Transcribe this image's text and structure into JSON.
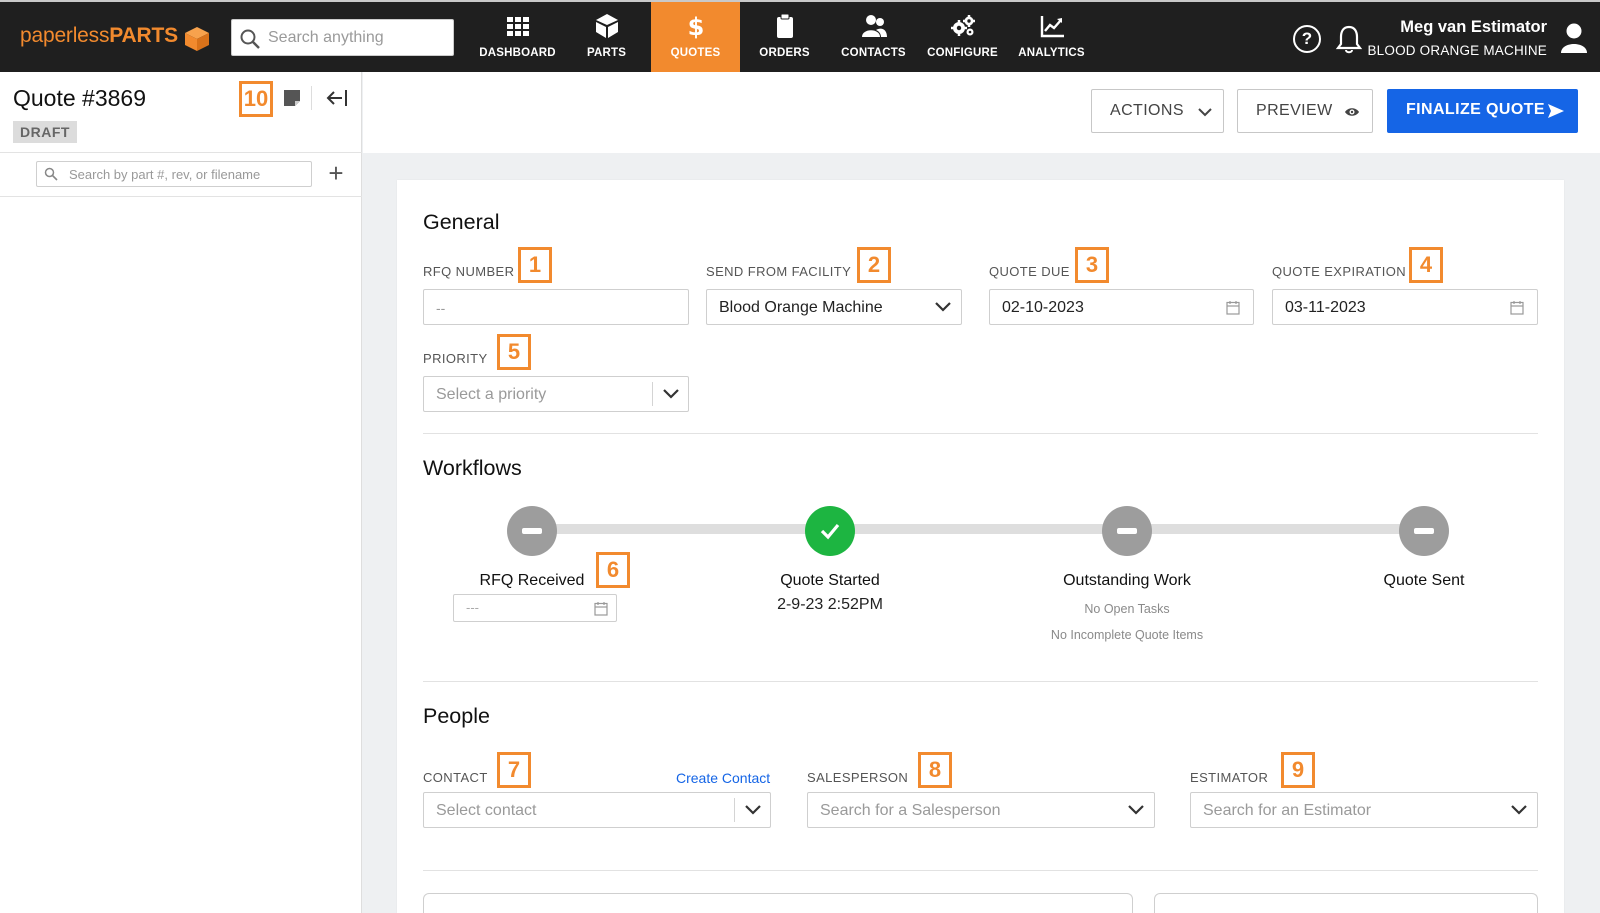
{
  "nav": {
    "logo_prefix": "paperless",
    "logo_suffix": "PARTS",
    "search_placeholder": "Search anything",
    "items": [
      {
        "label": "DASHBOARD",
        "icon": "grid-icon"
      },
      {
        "label": "PARTS",
        "icon": "cube-icon"
      },
      {
        "label": "QUOTES",
        "icon": "dollar-icon",
        "active": true
      },
      {
        "label": "ORDERS",
        "icon": "clipboard-icon"
      },
      {
        "label": "CONTACTS",
        "icon": "people-icon"
      },
      {
        "label": "CONFIGURE",
        "icon": "gears-icon"
      },
      {
        "label": "ANALYTICS",
        "icon": "chart-icon"
      }
    ],
    "help_glyph": "?",
    "user_name": "Meg van Estimator",
    "company": "BLOOD ORANGE MACHINE"
  },
  "left": {
    "quote_title": "Quote #3869",
    "status": "DRAFT",
    "part_search_placeholder": "Search by part #, rev, or filename",
    "add_glyph": "+",
    "badge": "10"
  },
  "actions": {
    "actions_label": "ACTIONS",
    "preview_label": "PREVIEW",
    "finalize_label": "FINALIZE QUOTE"
  },
  "general": {
    "heading": "General",
    "rfq_number": {
      "label": "RFQ NUMBER",
      "placeholder": "--",
      "badge": "1"
    },
    "facility": {
      "label": "SEND FROM FACILITY",
      "value": "Blood Orange Machine",
      "badge": "2"
    },
    "quote_due": {
      "label": "QUOTE DUE",
      "value": "02-10-2023",
      "badge": "3"
    },
    "quote_expiration": {
      "label": "QUOTE EXPIRATION",
      "value": "03-11-2023",
      "badge": "4"
    },
    "priority": {
      "label": "PRIORITY",
      "placeholder": "Select a priority",
      "badge": "5"
    }
  },
  "workflows": {
    "heading": "Workflows",
    "steps": [
      {
        "title": "RFQ Received",
        "date_placeholder": "---",
        "badge": "6",
        "state": "pending"
      },
      {
        "title": "Quote Started",
        "sub": "2-9-23 2:52PM",
        "state": "done"
      },
      {
        "title": "Outstanding Work",
        "note1": "No Open Tasks",
        "note2": "No Incomplete Quote Items",
        "state": "pending"
      },
      {
        "title": "Quote Sent",
        "state": "pending"
      }
    ]
  },
  "people": {
    "heading": "People",
    "contact": {
      "label": "CONTACT",
      "placeholder": "Select contact",
      "link": "Create Contact",
      "badge": "7"
    },
    "salesperson": {
      "label": "SALESPERSON",
      "placeholder": "Search for a Salesperson",
      "badge": "8"
    },
    "estimator": {
      "label": "ESTIMATOR",
      "placeholder": "Search for an Estimator",
      "badge": "9"
    }
  },
  "colors": {
    "accent": "#f28a2e",
    "primary": "#1565e6",
    "success": "#1db541",
    "nav_bg": "#1f1f1f"
  }
}
